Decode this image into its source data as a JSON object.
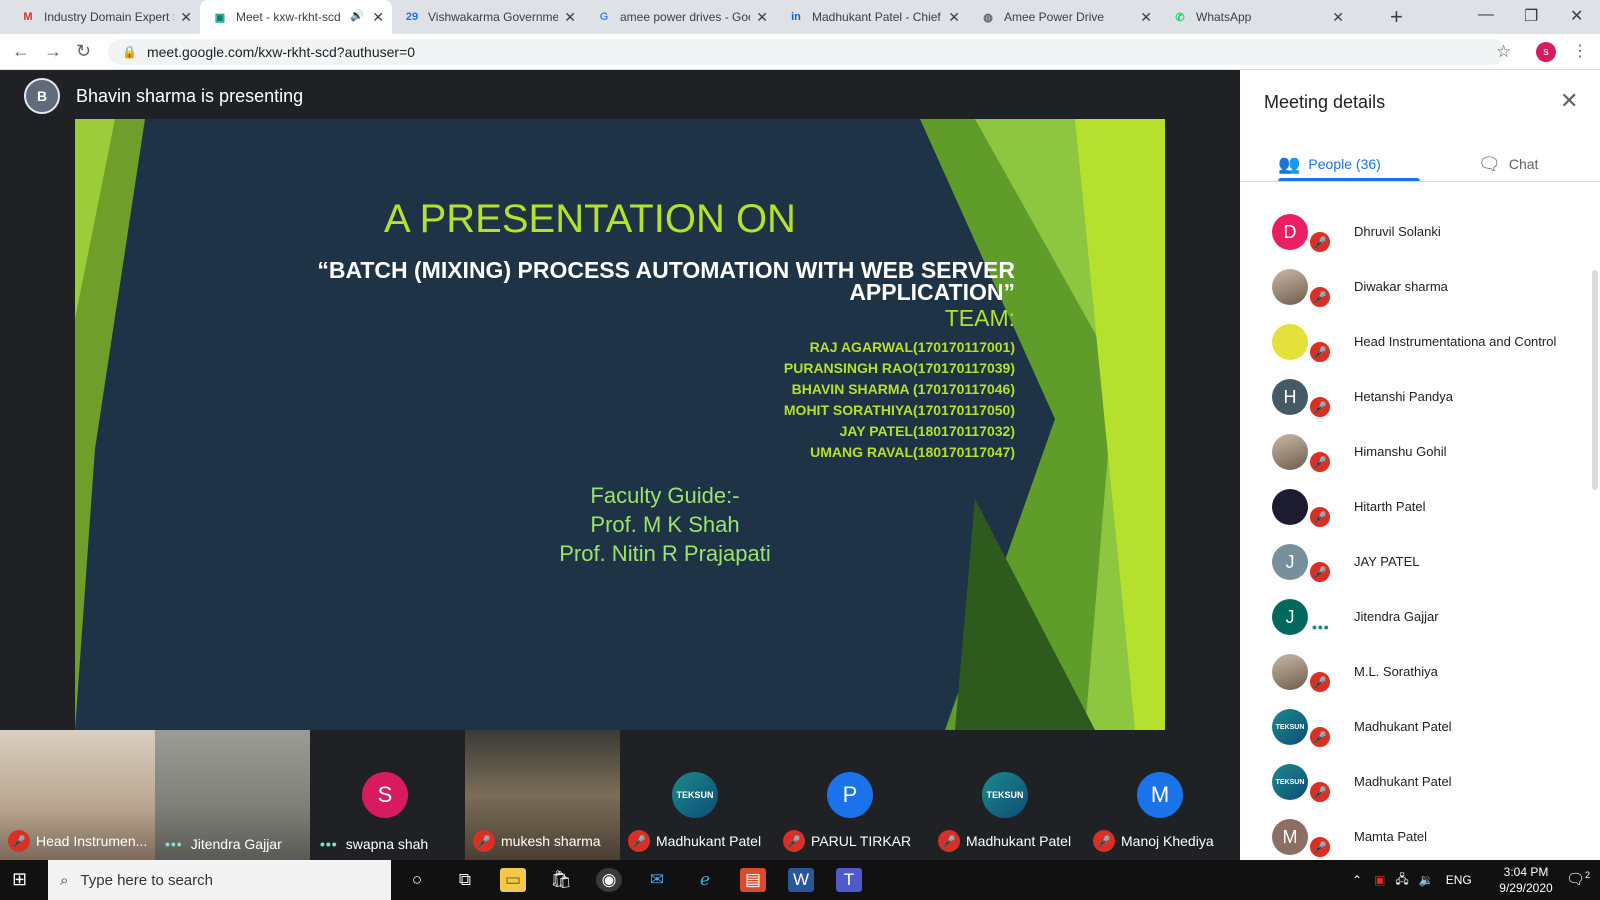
{
  "browser": {
    "tabs": [
      {
        "title": "Industry Domain Expert S",
        "icon": "gmail-icon",
        "icon_color": "#d93025",
        "glyph": "M"
      },
      {
        "title": "Meet - kxw-rkht-scd",
        "icon": "meet-icon",
        "icon_color": "#00897b",
        "glyph": "▣",
        "active": true,
        "audio": "🔊"
      },
      {
        "title": "Vishwakarma Governmen",
        "icon": "calendar-icon",
        "icon_color": "#1a73e8",
        "glyph": "29"
      },
      {
        "title": "amee power drives - Goo",
        "icon": "google-icon",
        "icon_color": "#4285f4",
        "glyph": "G"
      },
      {
        "title": "Madhukant Patel - Chief",
        "icon": "linkedin-icon",
        "icon_color": "#0a66c2",
        "glyph": "in"
      },
      {
        "title": "Amee Power Drive",
        "icon": "globe-icon",
        "icon_color": "#5f6368",
        "glyph": "◍"
      },
      {
        "title": "WhatsApp",
        "icon": "whatsapp-icon",
        "icon_color": "#25d366",
        "glyph": "✆"
      }
    ],
    "url": "meet.google.com/kxw-rkht-scd?authuser=0",
    "profile_initial": "s"
  },
  "meet": {
    "presenting_text": "Bhavin sharma is presenting",
    "slide": {
      "title": "A PRESENTATION ON",
      "subtitle_line1": "“BATCH (MIXING) PROCESS  AUTOMATION WITH WEB SERVER",
      "subtitle_line2": "APPLICATION”",
      "team_label": "TEAM:",
      "members": [
        "RAJ AGARWAL(170170117001)",
        "PURANSINGH RAO(170170117039)",
        "BHAVIN SHARMA (170170117046)",
        "MOHIT SORATHIYA(170170117050)",
        "JAY PATEL(180170117032)",
        "UMANG RAVAL(180170117047)"
      ],
      "guide_label": "Faculty Guide:-",
      "guide_1": "Prof.  M K Shah",
      "guide_2": "Prof.  Nitin R Prajapati"
    },
    "filmstrip": [
      {
        "name": "Head Instrumen...",
        "type": "camera",
        "status": "muted"
      },
      {
        "name": "Jitendra Gajjar",
        "type": "camera",
        "status": "speaking"
      },
      {
        "name": "swapna shah",
        "type": "avatar",
        "initial": "S",
        "color": "#d81b60",
        "status": "speaking"
      },
      {
        "name": "mukesh sharma",
        "type": "camera",
        "status": "muted"
      },
      {
        "name": "Madhukant Patel",
        "type": "teksun",
        "initial": "TEKSUN",
        "status": "muted"
      },
      {
        "name": "PARUL TIRKAR",
        "type": "avatar",
        "initial": "P",
        "color": "#1a73e8",
        "status": "muted"
      },
      {
        "name": "Madhukant Patel",
        "type": "teksun",
        "initial": "TEKSUN",
        "status": "muted"
      },
      {
        "name": "Manoj Khediya",
        "type": "avatar",
        "initial": "M",
        "color": "#1a73e8",
        "status": "muted"
      }
    ]
  },
  "panel": {
    "title": "Meeting details",
    "tab_people": "People (36)",
    "tab_chat": "Chat",
    "people": [
      {
        "name": "Dhruvil Solanki",
        "initial": "D",
        "color": "#e91e63",
        "status": "muted"
      },
      {
        "name": "Diwakar sharma",
        "initial": "",
        "color": "photo",
        "status": "muted"
      },
      {
        "name": "Head Instrumentationa and Control",
        "initial": "",
        "color": "yellow",
        "status": "muted"
      },
      {
        "name": "Hetanshi Pandya",
        "initial": "H",
        "color": "#455a64",
        "status": "muted"
      },
      {
        "name": "Himanshu Gohil",
        "initial": "",
        "color": "photo",
        "status": "muted"
      },
      {
        "name": "Hitarth Patel",
        "initial": "",
        "color": "#1c1c2e",
        "status": "muted"
      },
      {
        "name": "JAY PATEL",
        "initial": "J",
        "color": "#78909c",
        "status": "muted"
      },
      {
        "name": "Jitendra Gajjar",
        "initial": "J",
        "color": "#00695c",
        "status": "speaking"
      },
      {
        "name": "M.L. Sorathiya",
        "initial": "",
        "color": "photo",
        "status": "muted"
      },
      {
        "name": "Madhukant Patel",
        "initial": "TEKSUN",
        "color": "teksun",
        "status": "muted"
      },
      {
        "name": "Madhukant Patel",
        "initial": "TEKSUN",
        "color": "teksun",
        "status": "muted"
      },
      {
        "name": "Mamta Patel",
        "initial": "M",
        "color": "#8d6e63",
        "status": "muted"
      }
    ]
  },
  "taskbar": {
    "search_placeholder": "Type here to search",
    "language": "ENG",
    "time": "3:04 PM",
    "date": "9/29/2020",
    "notification_count": "2"
  }
}
